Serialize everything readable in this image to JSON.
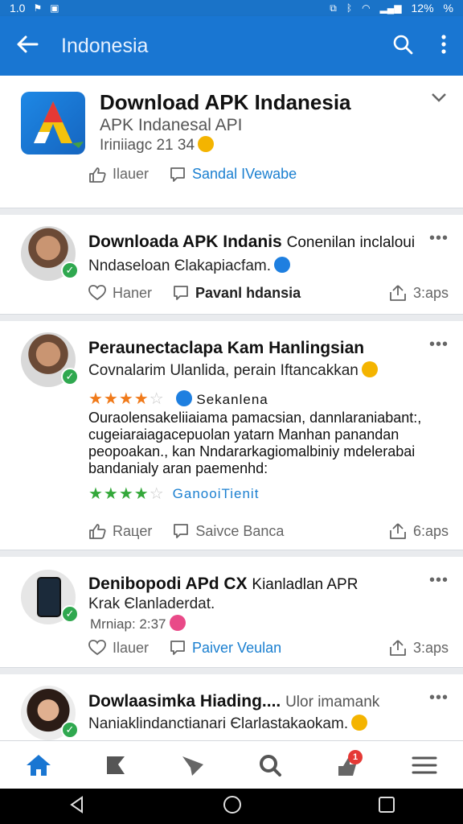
{
  "status_bar": {
    "left_text": "1.0",
    "left_icons": [
      "flag-icon",
      "sim-icon"
    ],
    "battery_text": "12%",
    "right_extra": "%"
  },
  "app_bar": {
    "title": "Indonesia",
    "background": "#1976d2"
  },
  "feed": {
    "app_card": {
      "title": "Download APK Indanesia",
      "subtitle": "APK  Indanesal API",
      "meta": "Iriпiiagc 21 34",
      "action_like": "Ilauer",
      "action_comment": "Sandal IVewabe"
    },
    "posts": [
      {
        "headline_bold": "Downloada APK Indanis",
        "headline_light": "Conenilan inclaloui",
        "text": "Nndaseloan Єlakapiacfam.",
        "action_like": "Haner",
        "action_comment": "Pavanl hdansia",
        "shares": "3:aps"
      },
      {
        "headline_bold": "Peraunectaclapa Kam Hanlingsian",
        "text": "Covnalarim Ulanlida, perain Iftancakkan",
        "rating_1": {
          "value": 3.5,
          "max": 5,
          "label": "Sekanlena"
        },
        "body": "Ouraolensakeliiaiama pamacsian, dannlaraniabant:, cugeiaraiagacepuolan yatarn Manhan panandan peopoakan., kan Nndararkagiomalbiniy mdelerabai bandanialy  aran paemenhd:",
        "rating_2": {
          "value": 3.5,
          "max": 5,
          "label": "GanooiTienit"
        },
        "action_like": "Raцer",
        "action_comment": "Saivce Banca",
        "shares": "6:aps"
      },
      {
        "headline_bold": "Denibopodi APd CX",
        "headline_light": "Kianladlan APR",
        "text": "Krak Єlanladerdat.",
        "meta": "Mrniap: 2:37",
        "action_like": "Ilauer",
        "action_comment": "Paiver Veulan",
        "shares": "3:aps"
      },
      {
        "headline_bold": "Dowlaasimka Hiading....",
        "headline_light": "Ulor imamank",
        "text": "Naniaklindanctianari Єlarlastakaokam."
      }
    ]
  },
  "bottom_nav": {
    "items": [
      "home-icon",
      "flag-icon",
      "send-icon",
      "search-icon",
      "notifications-icon",
      "menu-icon"
    ],
    "notification_count": "1"
  },
  "colors": {
    "accent": "#1976d2",
    "link": "#1a7fd0",
    "verified": "#2fa84f",
    "star_orange": "#f07a1a",
    "star_green": "#34a83a"
  }
}
